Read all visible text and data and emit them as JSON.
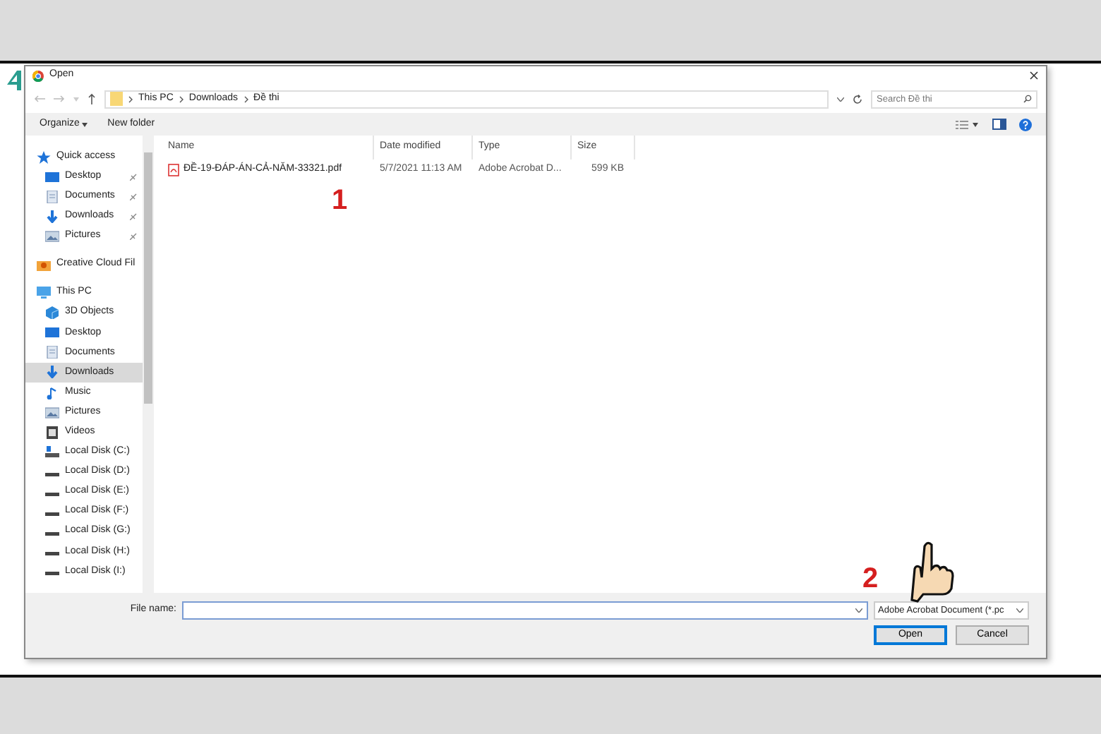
{
  "window": {
    "title": "Open"
  },
  "address": {
    "crumbs": [
      "This PC",
      "Downloads",
      "Đề thi"
    ],
    "search": {
      "placeholder": "Search Đề thi"
    }
  },
  "toolbar": {
    "organize": "Organize",
    "new_folder": "New folder"
  },
  "sidebar": {
    "groups": [
      {
        "label": "Quick access",
        "kind": "quick-access",
        "children": [
          {
            "label": "Desktop",
            "kind": "desktop",
            "pinned": true,
            "selected": false
          },
          {
            "label": "Documents",
            "kind": "documents",
            "pinned": true,
            "selected": false
          },
          {
            "label": "Downloads",
            "kind": "downloads",
            "pinned": true,
            "selected": false
          },
          {
            "label": "Pictures",
            "kind": "pictures",
            "pinned": true,
            "selected": false
          }
        ]
      },
      {
        "label": "Creative Cloud Fil",
        "kind": "cloud"
      },
      {
        "label": "This PC",
        "kind": "pc",
        "children": [
          {
            "label": "3D Objects",
            "kind": "objects",
            "pinned": false,
            "selected": false
          },
          {
            "label": "Desktop",
            "kind": "desktop",
            "pinned": false,
            "selected": false
          },
          {
            "label": "Documents",
            "kind": "documents",
            "pinned": false,
            "selected": false
          },
          {
            "label": "Downloads",
            "kind": "downloads",
            "pinned": false,
            "selected": true
          },
          {
            "label": "Music",
            "kind": "music",
            "pinned": false,
            "selected": false
          },
          {
            "label": "Pictures",
            "kind": "pictures",
            "pinned": false,
            "selected": false
          },
          {
            "label": "Videos",
            "kind": "videos",
            "pinned": false,
            "selected": false
          },
          {
            "label": "Local Disk (C:)",
            "kind": "system-drive",
            "pinned": false,
            "selected": false
          },
          {
            "label": "Local Disk (D:)",
            "kind": "drive",
            "pinned": false,
            "selected": false
          },
          {
            "label": "Local Disk (E:)",
            "kind": "drive",
            "pinned": false,
            "selected": false
          },
          {
            "label": "Local Disk (F:)",
            "kind": "drive",
            "pinned": false,
            "selected": false
          },
          {
            "label": "Local Disk (G:)",
            "kind": "drive",
            "pinned": false,
            "selected": false
          },
          {
            "label": "Local Disk (H:)",
            "kind": "drive",
            "pinned": false,
            "selected": false
          },
          {
            "label": "Local Disk (I:)",
            "kind": "drive",
            "pinned": false,
            "selected": false
          }
        ]
      }
    ]
  },
  "table": {
    "columns": [
      "Name",
      "Date modified",
      "Type",
      "Size"
    ],
    "rows": [
      {
        "cells": [
          "ĐỀ-19-ĐÁP-ÁN-CẢ-NĂM-33321.pdf",
          "5/7/2021 11:13 AM",
          "Adobe Acrobat D...",
          "599 KB"
        ]
      }
    ]
  },
  "footer": {
    "file_name_label": "File name:",
    "filter": "Adobe Acrobat Document (*.pc",
    "buttons": [
      {
        "label": "Open",
        "selected": true
      },
      {
        "label": "Cancel",
        "selected": false
      }
    ]
  },
  "annotations": [
    "1",
    "2"
  ]
}
